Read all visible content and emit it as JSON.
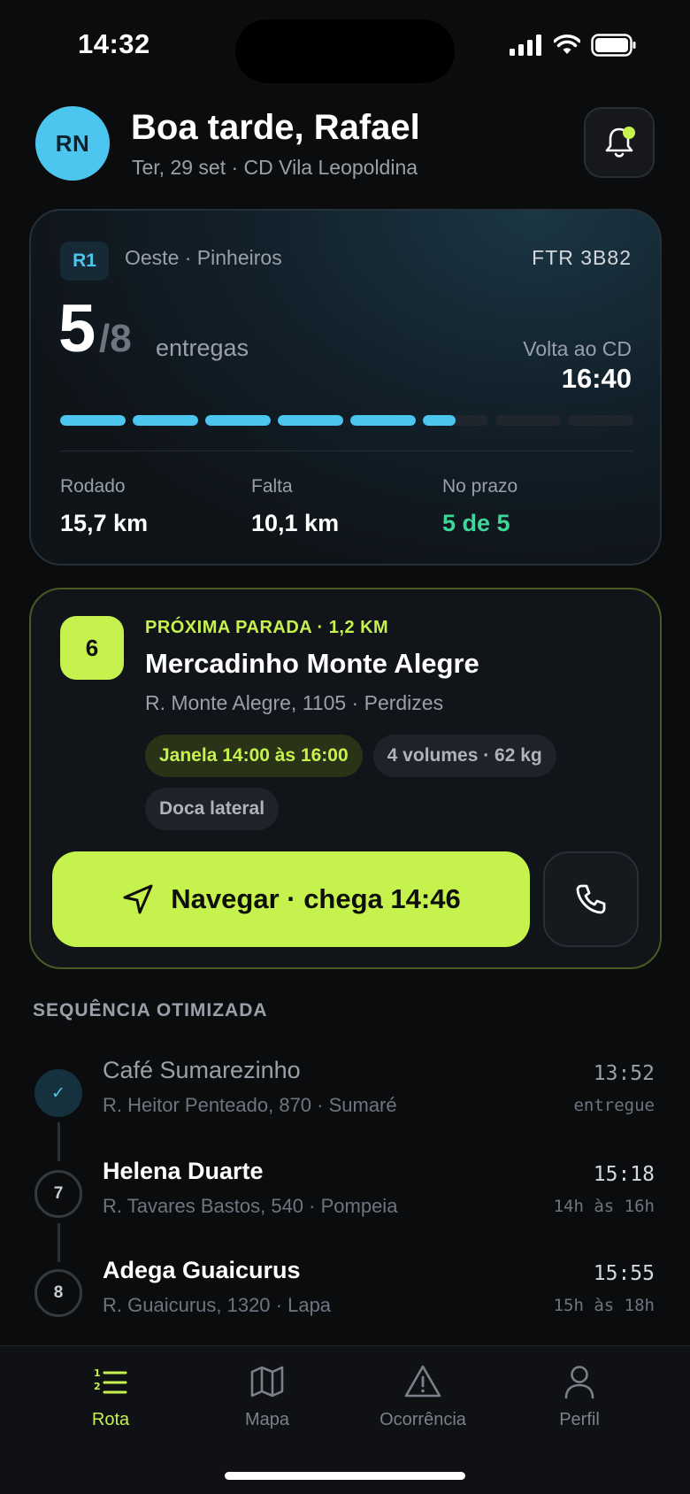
{
  "status_bar": {
    "time": "14:32"
  },
  "header": {
    "avatar_initials": "RN",
    "greeting": "Boa tarde, Rafael",
    "subtitle": "Ter, 29 set · CD Vila Leopoldina"
  },
  "route": {
    "badge": "R1",
    "area": "Oeste · Pinheiros",
    "plate": "FTR 3B82",
    "delivered": "5",
    "total": "/8",
    "unit": "entregas",
    "return_label": "Volta ao CD",
    "return_time": "16:40",
    "progress_segments": [
      1,
      1,
      1,
      1,
      1,
      0.5,
      0,
      0
    ],
    "stats": [
      {
        "label": "Rodado",
        "value": "15,7 km"
      },
      {
        "label": "Falta",
        "value": "10,1 km"
      },
      {
        "label": "No prazo",
        "value": "5 de 5"
      }
    ]
  },
  "next_stop": {
    "number": "6",
    "eyebrow": "PRÓXIMA PARADA · 1,2 KM",
    "name": "Mercadinho Monte Alegre",
    "address": "R. Monte Alegre, 1105 · Perdizes",
    "chips": [
      "Janela 14:00 às 16:00",
      "4 volumes · 62 kg",
      "Doca lateral"
    ],
    "navigate_label": "Navegar · chega 14:46"
  },
  "sequence": {
    "title": "SEQUÊNCIA OTIMIZADA",
    "items": [
      {
        "marker": "✓",
        "name": "Café Sumarezinho",
        "address": "R. Heitor Penteado, 870 · Sumaré",
        "time": "13:52",
        "note": "entregue",
        "done": true
      },
      {
        "marker": "7",
        "name": "Helena Duarte",
        "address": "R. Tavares Bastos, 540 · Pompeia",
        "time": "15:18",
        "note": "14h às 16h",
        "done": false
      },
      {
        "marker": "8",
        "name": "Adega Guaicurus",
        "address": "R. Guaicurus, 1320 · Lapa",
        "time": "15:55",
        "note": "15h às 18h",
        "done": false
      }
    ]
  },
  "tabs": [
    {
      "label": "Rota",
      "icon": "list-ordered-icon",
      "active": true
    },
    {
      "label": "Mapa",
      "icon": "map-icon",
      "active": false
    },
    {
      "label": "Ocorrência",
      "icon": "alert-triangle-icon",
      "active": false
    },
    {
      "label": "Perfil",
      "icon": "user-icon",
      "active": false
    }
  ],
  "colors": {
    "accent": "#c6f24e",
    "primary": "#4cc6ee",
    "success": "#3fd69a",
    "background": "#0b0c0e"
  }
}
